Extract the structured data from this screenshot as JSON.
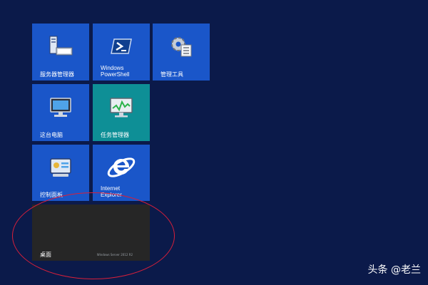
{
  "tiles": {
    "server_manager": {
      "label": "服务器管理器",
      "icon": "server-manager-icon"
    },
    "powershell": {
      "label": "Windows\nPowerShell",
      "icon": "powershell-icon"
    },
    "admin_tools": {
      "label": "管理工具",
      "icon": "admin-tools-icon"
    },
    "this_pc": {
      "label": "这台电脑",
      "icon": "computer-icon"
    },
    "task_manager": {
      "label": "任务管理器",
      "icon": "task-manager-icon"
    },
    "control_panel": {
      "label": "控制面板",
      "icon": "control-panel-icon"
    },
    "internet_explorer": {
      "label": "Internet\nExplorer",
      "icon": "internet-explorer-icon"
    },
    "desktop": {
      "label": "桌面",
      "watermark": "Windows Server 2012 R2"
    }
  },
  "colors": {
    "background": "#0b1a4a",
    "tile_blue": "#1a56c9",
    "tile_teal": "#0e8f96",
    "tile_dark": "#262626",
    "annotation_circle": "#d81f3a"
  },
  "watermark": "头条 @老兰"
}
